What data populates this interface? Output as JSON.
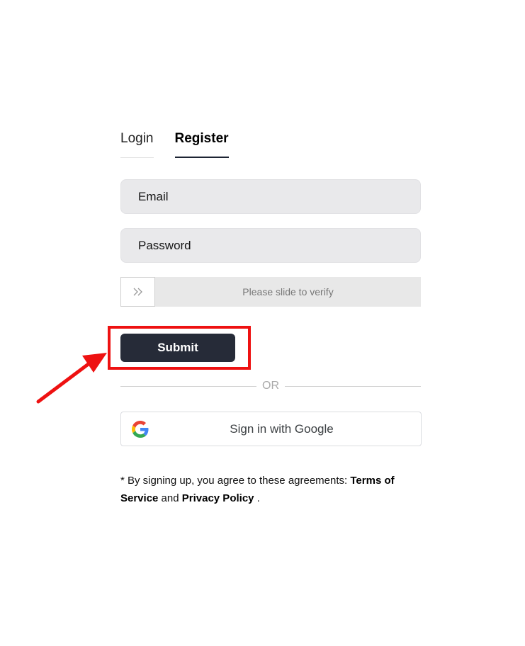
{
  "tabs": {
    "login": "Login",
    "register": "Register"
  },
  "form": {
    "email_placeholder": "Email",
    "password_placeholder": "Password",
    "slider_text": "Please slide to verify",
    "submit_label": "Submit"
  },
  "divider": {
    "text": "OR"
  },
  "google": {
    "label": "Sign in with Google",
    "icon": "google-g-icon"
  },
  "agreement": {
    "prefix": "* By signing up, you agree to these agreements: ",
    "terms": "Terms of Service",
    "conjunction": " and ",
    "privacy": "Privacy Policy",
    "suffix": " ."
  },
  "colors": {
    "annotation": "#ee1111",
    "submit_bg": "#262b38",
    "field_bg": "#e9e9eb"
  }
}
